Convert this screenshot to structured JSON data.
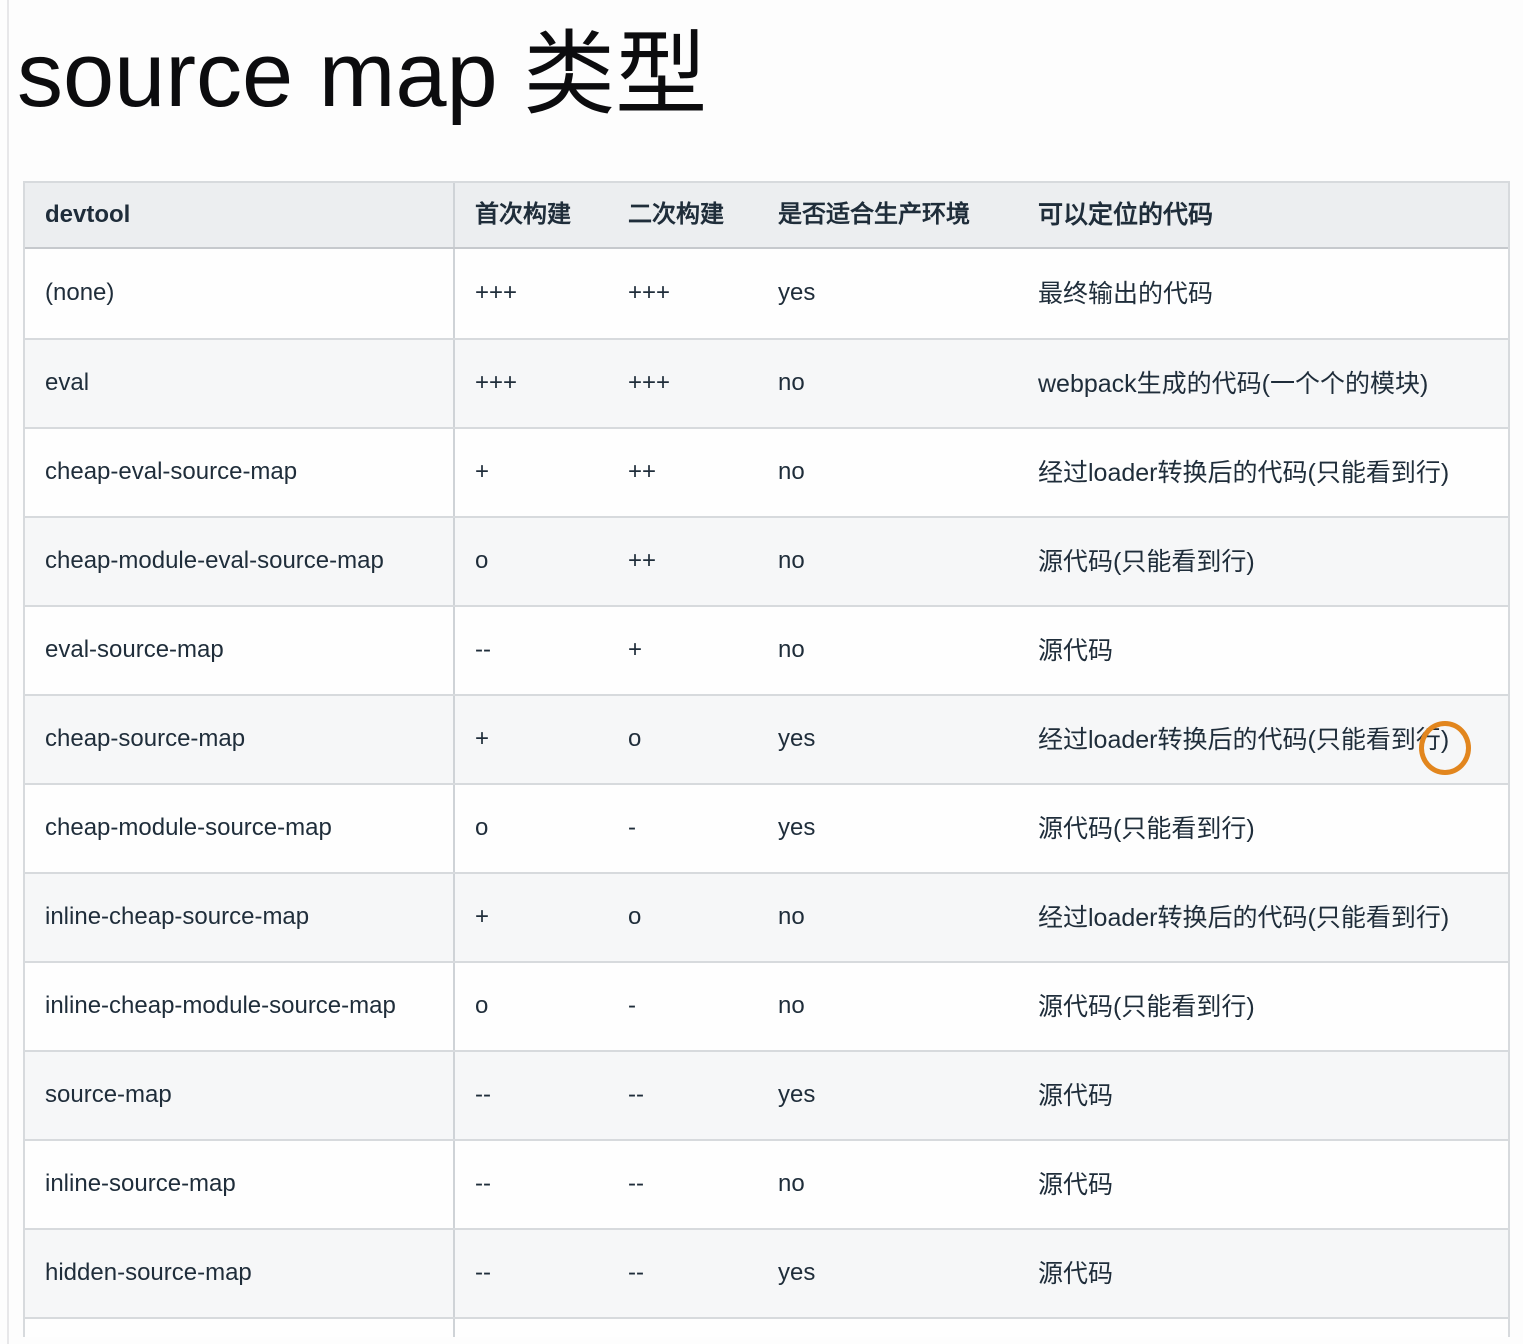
{
  "page": {
    "title": "source map 类型"
  },
  "table": {
    "columns": [
      "devtool",
      "首次构建",
      "二次构建",
      "是否适合生产环境",
      "可以定位的代码"
    ],
    "rows": [
      {
        "devtool": "(none)",
        "first_build": "+++",
        "second_build": "+++",
        "production_ready": "yes",
        "locatable_code": "最终输出的代码"
      },
      {
        "devtool": "eval",
        "first_build": "+++",
        "second_build": "+++",
        "production_ready": "no",
        "locatable_code": "webpack生成的代码(一个个的模块)"
      },
      {
        "devtool": "cheap-eval-source-map",
        "first_build": "+",
        "second_build": "++",
        "production_ready": "no",
        "locatable_code": "经过loader转换后的代码(只能看到行)"
      },
      {
        "devtool": "cheap-module-eval-source-map",
        "first_build": "o",
        "second_build": "++",
        "production_ready": "no",
        "locatable_code": "源代码(只能看到行)"
      },
      {
        "devtool": "eval-source-map",
        "first_build": "--",
        "second_build": "+",
        "production_ready": "no",
        "locatable_code": "源代码"
      },
      {
        "devtool": "cheap-source-map",
        "first_build": "+",
        "second_build": "o",
        "production_ready": "yes",
        "locatable_code": "经过loader转换后的代码(只能看到行)"
      },
      {
        "devtool": "cheap-module-source-map",
        "first_build": "o",
        "second_build": "-",
        "production_ready": "yes",
        "locatable_code": "源代码(只能看到行)"
      },
      {
        "devtool": "inline-cheap-source-map",
        "first_build": "+",
        "second_build": "o",
        "production_ready": "no",
        "locatable_code": "经过loader转换后的代码(只能看到行)"
      },
      {
        "devtool": "inline-cheap-module-source-map",
        "first_build": "o",
        "second_build": "-",
        "production_ready": "no",
        "locatable_code": "源代码(只能看到行)"
      },
      {
        "devtool": "source-map",
        "first_build": "--",
        "second_build": "--",
        "production_ready": "yes",
        "locatable_code": "源代码"
      },
      {
        "devtool": "inline-source-map",
        "first_build": "--",
        "second_build": "--",
        "production_ready": "no",
        "locatable_code": "源代码"
      },
      {
        "devtool": "hidden-source-map",
        "first_build": "--",
        "second_build": "--",
        "production_ready": "yes",
        "locatable_code": "源代码"
      }
    ]
  },
  "annotation": {
    "shape": "hand-drawn-circle",
    "color": "#e2861e",
    "circled_text": "到行",
    "on_row": "cheap-source-map"
  },
  "colors": {
    "header_bg": "#eceef0",
    "row_alt_bg": "#f6f7f8",
    "border": "#d7dadd",
    "text": "#1f2d3a",
    "accent": "#e2861e"
  }
}
